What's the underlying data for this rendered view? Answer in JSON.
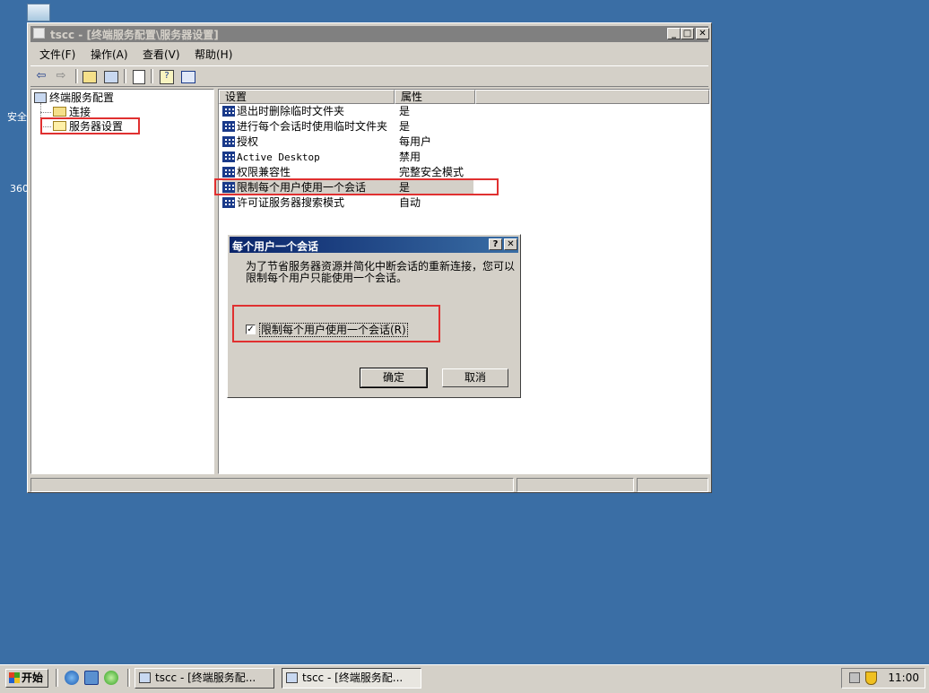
{
  "desktop": {
    "labels": [
      "安全",
      "360"
    ]
  },
  "window": {
    "title": "tscc - [终端服务配置\\服务器设置]",
    "caption_buttons": {
      "minimize": "_",
      "maximize": "□",
      "close": "✕"
    },
    "menu": [
      "文件(F)",
      "操作(A)",
      "查看(V)",
      "帮助(H)"
    ]
  },
  "tree": {
    "root": "终端服务配置",
    "children": [
      "连接",
      "服务器设置"
    ]
  },
  "list": {
    "columns": [
      "设置",
      "属性"
    ],
    "rows": [
      {
        "name": "退出时删除临时文件夹",
        "value": "是"
      },
      {
        "name": "进行每个会话时使用临时文件夹",
        "value": "是"
      },
      {
        "name": "授权",
        "value": "每用户"
      },
      {
        "name": "Active Desktop",
        "value": "禁用"
      },
      {
        "name": "权限兼容性",
        "value": "完整安全模式"
      },
      {
        "name": "限制每个用户使用一个会话",
        "value": "是"
      },
      {
        "name": "许可证服务器搜索模式",
        "value": "自动"
      }
    ]
  },
  "dialog": {
    "title": "每个用户一个会话",
    "help_btn": "?",
    "close_btn": "✕",
    "message": "为了节省服务器资源并简化中断会话的重新连接，您可以限制每个用户只能使用一个会话。",
    "checkbox_label": "限制每个用户使用一个会话(R)",
    "checkbox_checked": true,
    "ok": "确定",
    "cancel": "取消"
  },
  "taskbar": {
    "start": "开始",
    "tasks": [
      "tscc - [终端服务配...",
      "tscc - [终端服务配..."
    ],
    "clock": "11:00"
  }
}
